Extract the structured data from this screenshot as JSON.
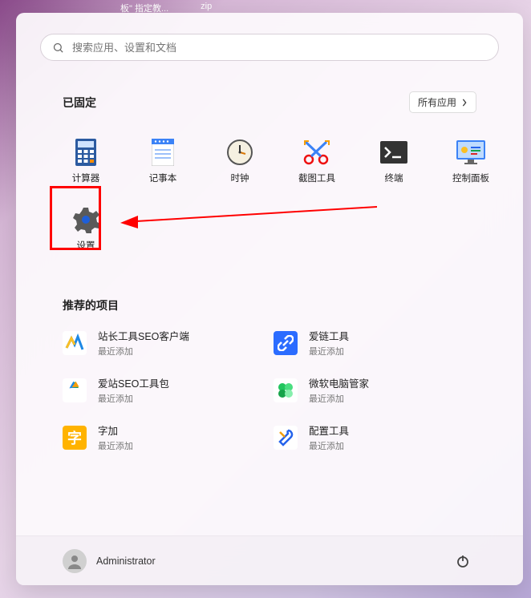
{
  "taskbar": {
    "hint1": "板\" 指定教...",
    "hint2": "zip"
  },
  "search": {
    "placeholder": "搜索应用、设置和文档"
  },
  "pinned": {
    "title": "已固定",
    "all_apps_label": "所有应用",
    "items": [
      {
        "label": "计算器",
        "icon": "calculator"
      },
      {
        "label": "记事本",
        "icon": "notepad"
      },
      {
        "label": "时钟",
        "icon": "clock"
      },
      {
        "label": "截图工具",
        "icon": "snip"
      },
      {
        "label": "终端",
        "icon": "terminal"
      },
      {
        "label": "控制面板",
        "icon": "control-panel"
      },
      {
        "label": "设置",
        "icon": "settings"
      }
    ]
  },
  "recommended": {
    "title": "推荐的项目",
    "items": [
      {
        "title": "站长工具SEO客户端",
        "subtitle": "最近添加",
        "color": "#ffb300",
        "icon": "zz"
      },
      {
        "title": "爱链工具",
        "subtitle": "最近添加",
        "color": "#2b6cff",
        "icon": "link"
      },
      {
        "title": "爱站SEO工具包",
        "subtitle": "最近添加",
        "color": "#3cb043",
        "icon": "recycle"
      },
      {
        "title": "微软电脑管家",
        "subtitle": "最近添加",
        "color": "#3cb043",
        "icon": "clover"
      },
      {
        "title": "字加",
        "subtitle": "最近添加",
        "color": "#ffb300",
        "icon": "char"
      },
      {
        "title": "配置工具",
        "subtitle": "最近添加",
        "color": "#2b6cff",
        "icon": "wrench"
      }
    ]
  },
  "footer": {
    "username": "Administrator"
  },
  "annotation": {
    "highlight_target": "settings",
    "arrow": true
  }
}
